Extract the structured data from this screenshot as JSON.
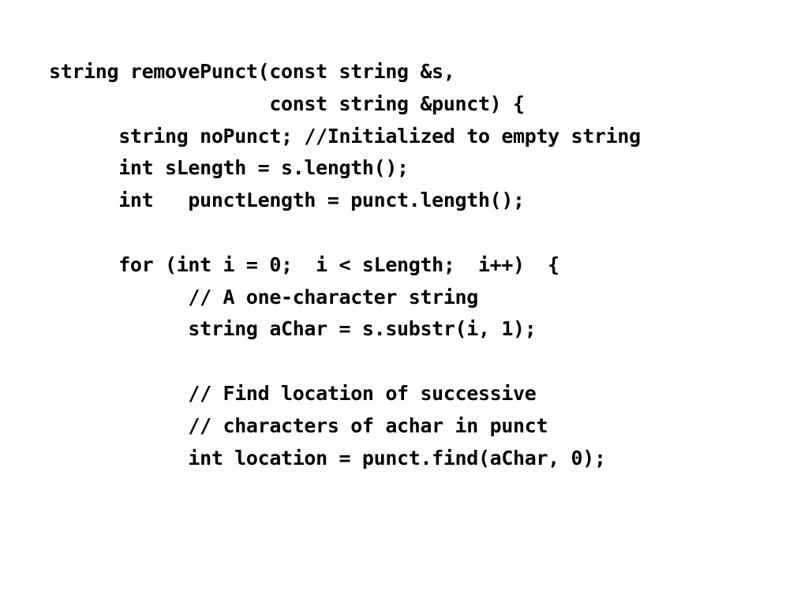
{
  "slide": {
    "background_color": "#ffffff",
    "text_color": "#000000",
    "kind": "code-listing-slide",
    "language": "C++"
  },
  "code": {
    "lines": [
      {
        "id": "line-1",
        "text": "string removePunct(const string &s,"
      },
      {
        "id": "line-2",
        "text": "                   const string &punct) {"
      },
      {
        "id": "line-3",
        "text": "      string noPunct; //Initialized to empty string"
      },
      {
        "id": "line-4",
        "text": "      int sLength = s.length();"
      },
      {
        "id": "line-5",
        "text": "      int   punctLength = punct.length();"
      },
      {
        "id": "line-6",
        "text": ""
      },
      {
        "id": "line-7",
        "text": "      for (int i = 0;  i < sLength;  i++)  {"
      },
      {
        "id": "line-8",
        "text": "            // A one-character string"
      },
      {
        "id": "line-9",
        "text": "            string aChar = s.substr(i, 1);"
      },
      {
        "id": "line-10",
        "text": ""
      },
      {
        "id": "line-11",
        "text": "            // Find location of successive"
      },
      {
        "id": "line-12",
        "text": "            // characters of achar in punct"
      },
      {
        "id": "line-13",
        "text": "            int location = punct.find(aChar, 0);"
      }
    ]
  }
}
